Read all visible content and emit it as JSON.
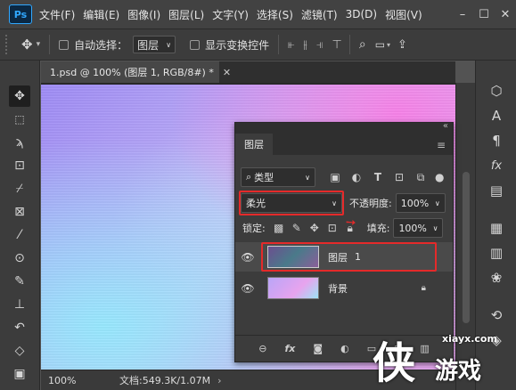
{
  "app": {
    "logo": "Ps",
    "menu": [
      "文件(F)",
      "编辑(E)",
      "图像(I)",
      "图层(L)",
      "文字(Y)",
      "选择(S)",
      "滤镜(T)",
      "3D(D)",
      "视图(V)"
    ],
    "window_controls": [
      "minimize",
      "maximize",
      "close"
    ]
  },
  "options_bar": {
    "auto_select_label": "自动选择：",
    "auto_select_target": "图层",
    "show_transform_label": "显示变换控件"
  },
  "document": {
    "tab_title": "1.psd @ 100% (图层 1, RGB/8#) *",
    "zoom": "100%",
    "doc_info": "文档:549.3K/1.07M"
  },
  "layers_panel": {
    "tab_label": "图层",
    "filter_kind": "类型",
    "blend_mode": "柔光",
    "opacity_label": "不透明度:",
    "opacity_value": "100%",
    "lock_label": "锁定:",
    "fill_label": "填充:",
    "fill_value": "100%",
    "layers": [
      {
        "name": "图层",
        "suffix": "1",
        "selected": true,
        "visible": true,
        "locked": false
      },
      {
        "name": "背景",
        "suffix": "",
        "selected": false,
        "visible": true,
        "locked": true
      }
    ],
    "bottom_icons": [
      "link-icon",
      "fx-icon",
      "mask-icon",
      "adjustment-icon",
      "folder-icon",
      "new-layer-icon",
      "trash-icon"
    ],
    "fx_label": "fx"
  },
  "watermark": {
    "url": "xiayx.com",
    "char": "侠",
    "text": "游戏"
  },
  "colors": {
    "highlight": "#e52a2a",
    "app_bg": "#535353",
    "panel_bg": "#3c3c3c"
  }
}
